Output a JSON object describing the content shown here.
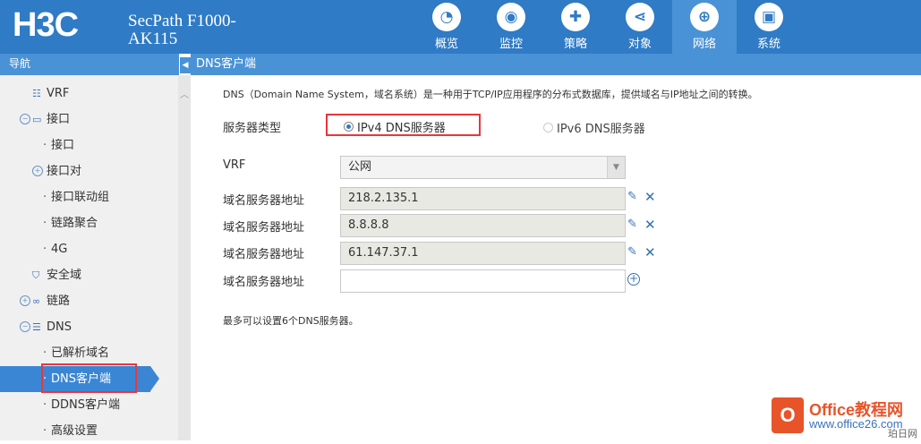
{
  "header": {
    "logo": "H3C",
    "product_line1": "SecPath F1000-",
    "product_line2": "AK115",
    "nav": [
      {
        "label": "概览",
        "icon": "dashboard-icon",
        "glyph": "◔"
      },
      {
        "label": "监控",
        "icon": "monitor-icon",
        "glyph": "◉"
      },
      {
        "label": "策略",
        "icon": "shield-icon",
        "glyph": "✚"
      },
      {
        "label": "对象",
        "icon": "share-icon",
        "glyph": "⋖"
      },
      {
        "label": "网络",
        "icon": "globe-icon",
        "glyph": "⊕",
        "active": true
      },
      {
        "label": "系统",
        "icon": "computer-icon",
        "glyph": "▣"
      }
    ]
  },
  "sidebar": {
    "title": "导航",
    "items": [
      {
        "label": "VRF",
        "type": "top"
      },
      {
        "label": "接口",
        "type": "group"
      },
      {
        "label": "接口",
        "type": "child"
      },
      {
        "label": "接口对",
        "type": "group-inner"
      },
      {
        "label": "接口联动组",
        "type": "child"
      },
      {
        "label": "链路聚合",
        "type": "child"
      },
      {
        "label": "4G",
        "type": "child"
      },
      {
        "label": "安全域",
        "type": "top"
      },
      {
        "label": "链路",
        "type": "group"
      },
      {
        "label": "DNS",
        "type": "group"
      },
      {
        "label": "已解析域名",
        "type": "child"
      },
      {
        "label": "DNS客户端",
        "type": "child",
        "active": true
      },
      {
        "label": "DDNS客户端",
        "type": "child"
      },
      {
        "label": "高级设置",
        "type": "child"
      }
    ]
  },
  "content": {
    "title": "DNS客户端",
    "description": "DNS（Domain Name System，域名系统）是一种用于TCP/IP应用程序的分布式数据库，提供域名与IP地址之间的转换。",
    "server_type_label": "服务器类型",
    "ipv4_option": "IPv4 DNS服务器",
    "ipv6_option": "IPv6 DNS服务器",
    "vrf_label": "VRF",
    "vrf_value": "公网",
    "server_label": "域名服务器地址",
    "servers": [
      "218.2.135.1",
      "8.8.8.8",
      "61.147.37.1",
      ""
    ],
    "note": "最多可以设置6个DNS服务器。"
  },
  "watermark": {
    "title": "Office教程网",
    "url": "www.office26.com",
    "sub": "珀日网"
  },
  "colors": {
    "header_bg": "#2f7bc5",
    "accent": "#4a92d6",
    "highlight_red": "#e8363c"
  }
}
